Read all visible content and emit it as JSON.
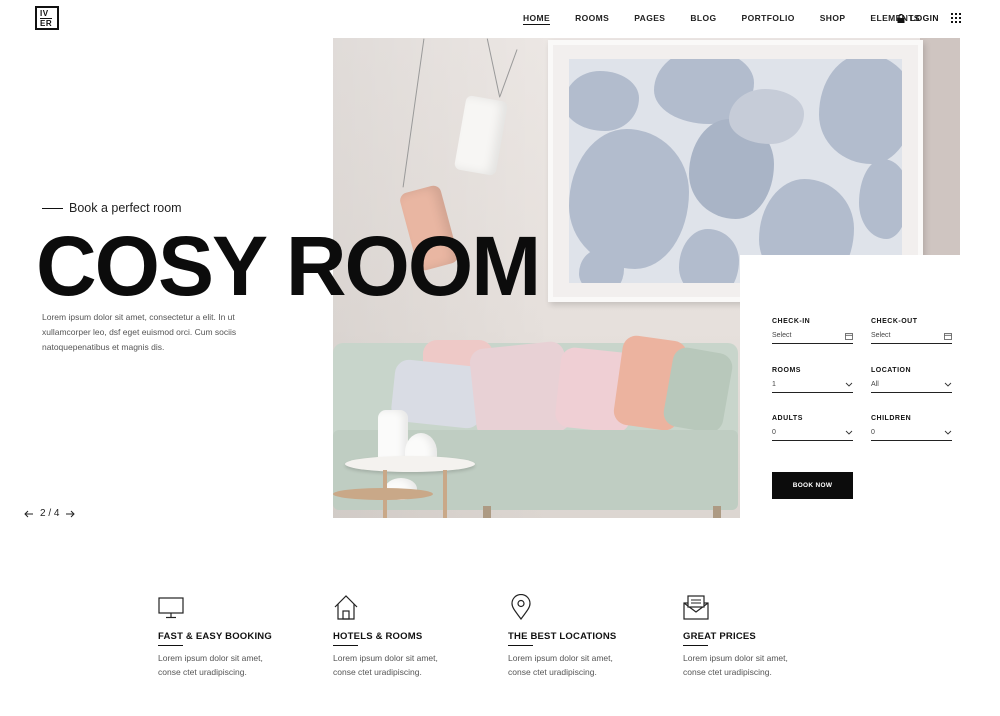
{
  "brand": {
    "logo_line1": "IV",
    "logo_line2": "ER"
  },
  "nav": {
    "items": [
      "HOME",
      "ROOMS",
      "PAGES",
      "BLOG",
      "PORTFOLIO",
      "SHOP",
      "ELEMENTS"
    ],
    "active": "HOME",
    "login_label": "LOGIN"
  },
  "hero": {
    "kicker": "Book a perfect room",
    "title": "COSY ROOM",
    "description": "Lorem ipsum dolor sit amet, consectetur a elit. In ut xullamcorper leo, dsf eget euismod orci. Cum sociis natoquepenatibus et magnis dis."
  },
  "booking": {
    "check_in": {
      "label": "CHECK-IN",
      "value": "Select"
    },
    "check_out": {
      "label": "CHECK-OUT",
      "value": "Select"
    },
    "rooms": {
      "label": "ROOMS",
      "value": "1"
    },
    "location": {
      "label": "LOCATION",
      "value": "All"
    },
    "adults": {
      "label": "ADULTS",
      "value": "0"
    },
    "children": {
      "label": "CHILDREN",
      "value": "0"
    },
    "button_label": "BOOK NOW"
  },
  "pager": {
    "text": "2 / 4"
  },
  "features": [
    {
      "icon": "monitor-icon",
      "title": "FAST & EASY BOOKING",
      "line1": "Lorem ipsum dolor sit amet,",
      "line2": "conse ctet uradipiscing."
    },
    {
      "icon": "house-icon",
      "title": "HOTELS & ROOMS",
      "line1": "Lorem ipsum dolor sit amet,",
      "line2": "conse ctet uradipiscing."
    },
    {
      "icon": "location-pin-icon",
      "title": "THE BEST LOCATIONS",
      "line1": "Lorem ipsum dolor sit amet,",
      "line2": "conse ctet uradipiscing."
    },
    {
      "icon": "envelope-icon",
      "title": "GREAT PRICES",
      "line1": "Lorem ipsum dolor sit amet,",
      "line2": "conse ctet uradipiscing."
    }
  ],
  "colors": {
    "accent": "#0c0c0c",
    "text_muted": "#555555",
    "background": "#ffffff"
  }
}
